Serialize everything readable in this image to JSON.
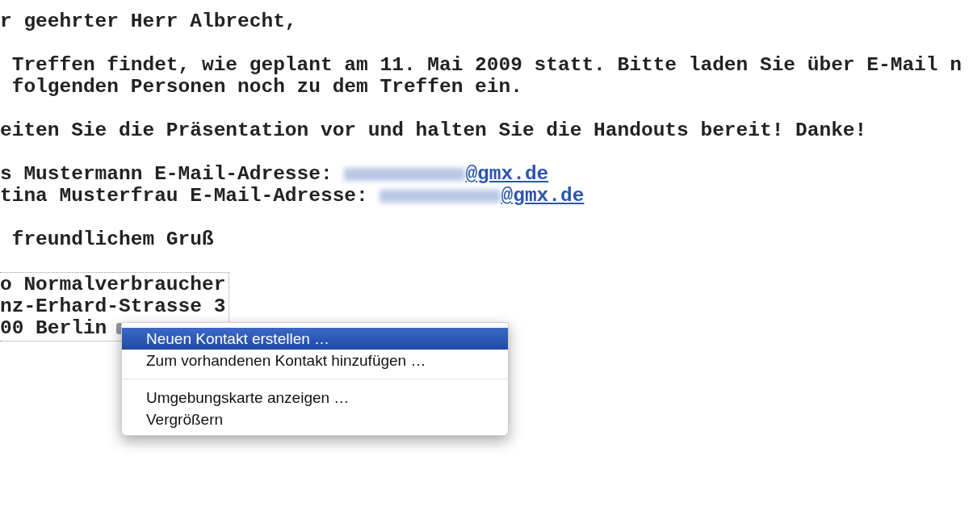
{
  "email_body": {
    "paragraphs": [
      {
        "lines": [
          {
            "kind": "text",
            "text": "r geehrter Herr Albrecht,"
          }
        ]
      },
      {
        "lines": [
          {
            "kind": "text",
            "text": " Treffen findet, wie geplant am 11. Mai 2009 statt. Bitte laden Sie über E-Mail n"
          },
          {
            "kind": "text",
            "text": " folgenden Personen noch zu dem Treffen ein."
          }
        ]
      },
      {
        "lines": [
          {
            "kind": "text",
            "text": "eiten Sie die Präsentation vor und halten Sie die Handouts bereit! Danke!"
          }
        ]
      },
      {
        "lines": [
          {
            "kind": "address",
            "text": "s Mustermann E-Mail-Adresse: ",
            "link": "@gmx.de"
          },
          {
            "kind": "address",
            "text": "tina Musterfrau E-Mail-Adresse: ",
            "link": "@gmx.de"
          }
        ]
      },
      {
        "lines": [
          {
            "kind": "text",
            "text": " freundlichem Gruß"
          }
        ]
      }
    ]
  },
  "signature": {
    "lines": [
      "o Normalverbraucher",
      "nz-Erhard-Strasse 3",
      "00 Berlin"
    ]
  },
  "context_menu": {
    "sections": [
      {
        "items": [
          {
            "label": "Neuen Kontakt erstellen …",
            "selected": true
          },
          {
            "label": "Zum vorhandenen Kontakt hinzufügen …",
            "selected": false
          }
        ]
      },
      {
        "items": [
          {
            "label": "Umgebungskarte anzeigen …",
            "selected": false
          },
          {
            "label": "Vergrößern",
            "selected": false
          }
        ]
      }
    ]
  }
}
